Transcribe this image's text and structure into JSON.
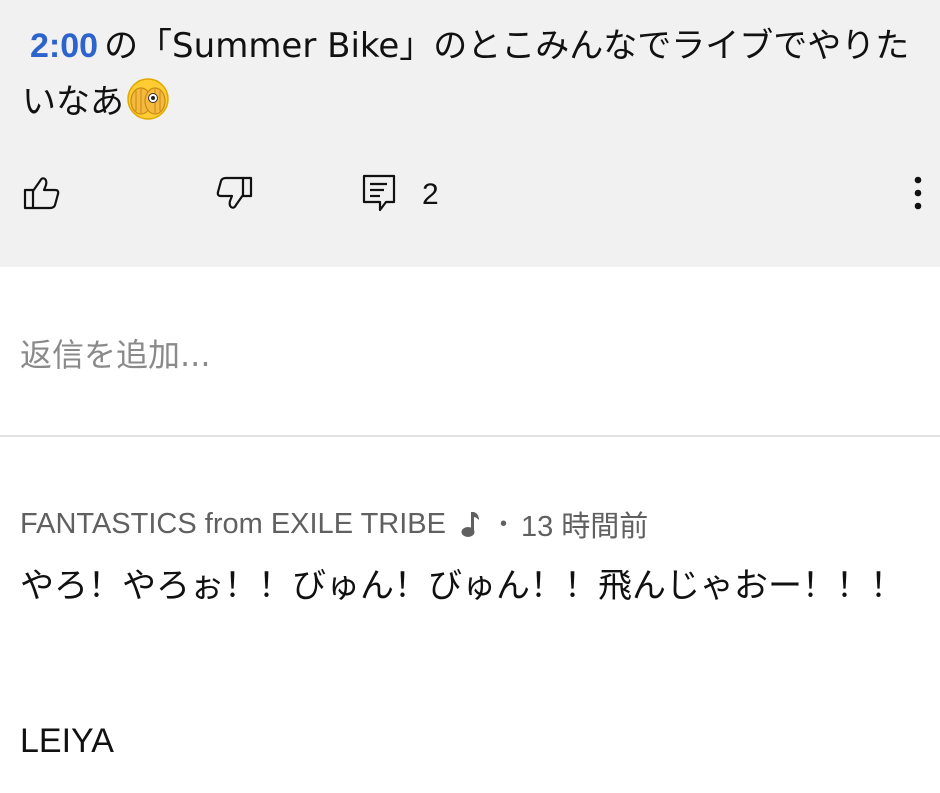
{
  "comment": {
    "timestamp_link": "2:00",
    "text_after_timestamp": "の「Summer Bike」のとこみんなでライブでやりたいなあ",
    "emoji": "face-peeking-hands-emoji"
  },
  "actions": {
    "reply_count": "2"
  },
  "reply_input": {
    "placeholder": "返信を追加..."
  },
  "reply": {
    "author": "FANTASTICS from EXILE TRIBE",
    "separator": "•",
    "time": "13 時間前",
    "text": "やろ！やろぉ！！びゅん！びゅん！！飛んじゃおー！！！",
    "signature": "LEIYA"
  },
  "colors": {
    "link_blue": "#2d63cc",
    "top_bg": "#f1f1f1",
    "muted": "#606060"
  }
}
